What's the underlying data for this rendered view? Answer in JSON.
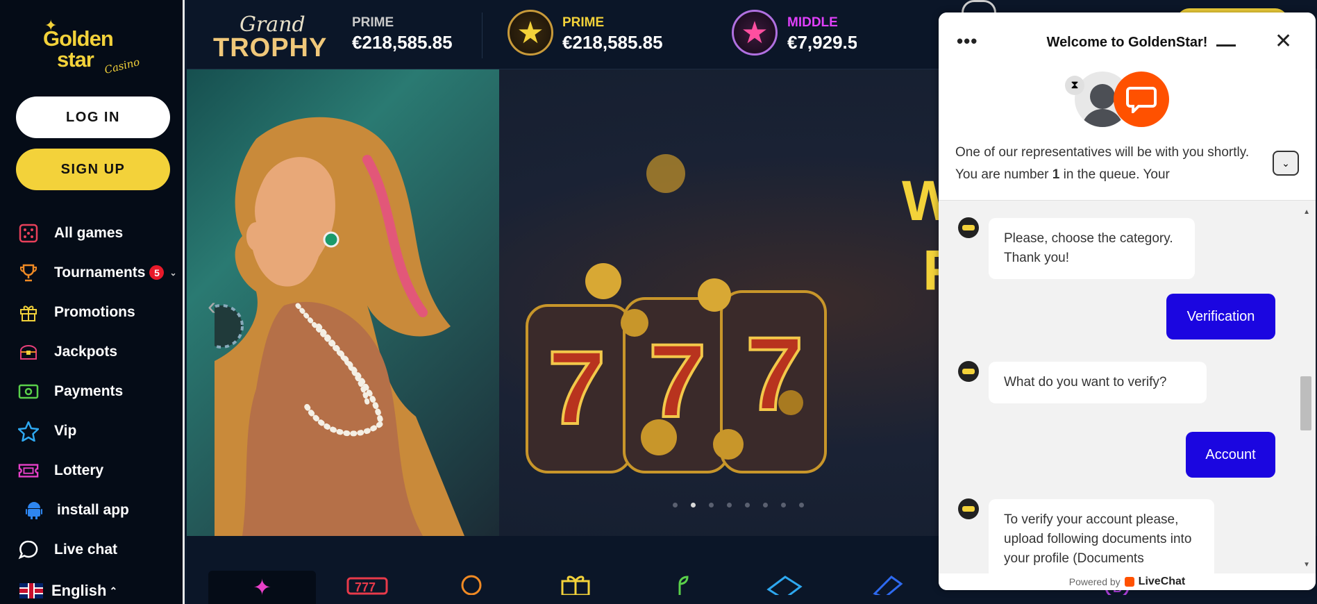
{
  "logo": {
    "line1": "Golden",
    "line2": "star",
    "line3": "Casino"
  },
  "auth": {
    "login_label": "LOG IN",
    "signup_label": "SIGN UP"
  },
  "nav": [
    {
      "label": "All games",
      "icon": "dice-icon"
    },
    {
      "label": "Tournaments",
      "icon": "trophy-icon",
      "badge": "5"
    },
    {
      "label": "Promotions",
      "icon": "gift-icon"
    },
    {
      "label": "Jackpots",
      "icon": "treasure-chest-icon"
    },
    {
      "label": "Payments",
      "icon": "banknote-icon"
    },
    {
      "label": "Vip",
      "icon": "star-icon"
    },
    {
      "label": "Lottery",
      "icon": "ticket-icon"
    },
    {
      "label": "install app",
      "icon": "android-icon"
    },
    {
      "label": "Live chat",
      "icon": "chat-bubble-icon"
    }
  ],
  "language": {
    "label": "English"
  },
  "jackpots": {
    "grand_script": "Grand",
    "grand_title": "TROPHY",
    "items": [
      {
        "label": "PRIME",
        "value": "€218,585.85",
        "color": "#c9c9c9"
      },
      {
        "label": "PRIME",
        "value": "€218,585.85",
        "color": "#f3d23a"
      },
      {
        "label": "MIDDLE",
        "value": "€7,929.5",
        "color": "#e040fb"
      }
    ]
  },
  "hero": {
    "headline_1": "W",
    "headline_2": "F",
    "slide_count": 8,
    "active_slide": 2
  },
  "chat": {
    "title": "Welcome to GoldenStar!",
    "queue_text_1": "One of our representatives will be with you shortly. You are number ",
    "queue_number": "1",
    "queue_text_2": " in the queue. Your",
    "messages": [
      {
        "from": "bot",
        "text": "Please, choose the category. Thank you!"
      },
      {
        "from": "user",
        "text": "Verification"
      },
      {
        "from": "bot",
        "text": "What do you want to verify?"
      },
      {
        "from": "user",
        "text": "Account"
      },
      {
        "from": "bot",
        "text": "To verify your account please, upload following documents into your profile (Documents"
      }
    ],
    "powered_by": "Powered by",
    "brand": "LiveChat"
  },
  "colors": {
    "accent": "#f3d23a",
    "chat_button": "#1b06e0",
    "livechat": "#ff5100"
  }
}
